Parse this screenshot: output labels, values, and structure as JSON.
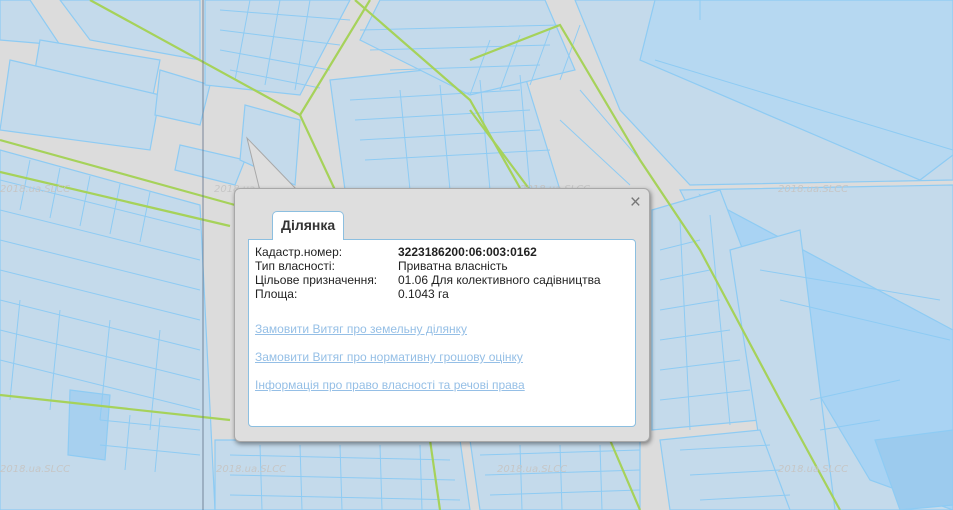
{
  "map": {
    "watermark": "2018.ua.SLCC",
    "colors": {
      "background": "#dcdcdc",
      "parcel_fill": "#c4daeb",
      "parcel_stroke": "#8ecbf3",
      "boundary_line": "#a6d25a",
      "highlight_fill": "#9ccbee"
    }
  },
  "popup": {
    "close_label": "×",
    "tab_label": "Ділянка",
    "fields": [
      {
        "label": "Кадастр.номер:",
        "value": "3223186200:06:003:0162"
      },
      {
        "label": "Тип власності:",
        "value": "Приватна власність"
      },
      {
        "label": "Цільове призначення:",
        "value": "01.06 Для колективного садівництва"
      },
      {
        "label": "Площа:",
        "value": "0.1043 га"
      }
    ],
    "links": [
      "Замовити Витяг про земельну ділянку",
      "Замовити Витяг про нормативну грошову оцінку",
      "Інформація про право власності та речові права"
    ]
  }
}
